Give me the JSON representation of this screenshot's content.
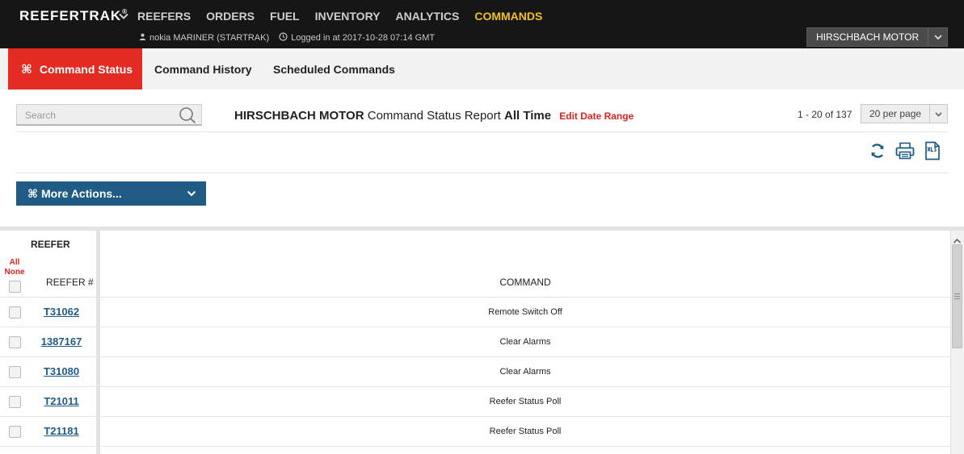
{
  "app": {
    "brand": "REEFERTRAK",
    "brand_mark": "®",
    "nav": [
      "REEFERS",
      "ORDERS",
      "FUEL",
      "INVENTORY",
      "ANALYTICS",
      "COMMANDS"
    ],
    "active_nav": "COMMANDS",
    "user": "nokia MARINER (STARTRAK)",
    "login": "Logged in at 2017-10-28 07:14 GMT",
    "company": "HIRSCHBACH MOTOR"
  },
  "tabs": {
    "command_status": "Command Status",
    "command_history": "Command History",
    "scheduled_commands": "Scheduled Commands"
  },
  "toolbar": {
    "search_placeholder": "Search",
    "report_company": "HIRSCHBACH MOTOR",
    "report_name": "Command Status Report",
    "report_range": "All Time",
    "edit_range": "Edit Date Range",
    "paging": "1 - 20 of 137",
    "per_page": "20 per page",
    "more_actions": "More Actions..."
  },
  "table": {
    "group_header": "REEFER",
    "all": "All",
    "none": "None",
    "col_reefer": "REEFER #",
    "col_command": "COMMAND",
    "rows": [
      {
        "reefer": "T31062",
        "command": "Remote Switch Off"
      },
      {
        "reefer": "1387167",
        "command": "Clear Alarms"
      },
      {
        "reefer": "T31080",
        "command": "Clear Alarms"
      },
      {
        "reefer": "T21011",
        "command": "Reefer Status Poll"
      },
      {
        "reefer": "T21181",
        "command": "Reefer Status Poll"
      }
    ]
  },
  "colors": {
    "topbar": "#161616",
    "active_nav": "#f2c21b",
    "active_tab": "#e32b24",
    "primary_button": "#1f5b85",
    "link": "#1f5b85",
    "alert_text": "#d7261f"
  },
  "icons": [
    "chevron-down-icon",
    "user-icon",
    "clock-icon",
    "command-icon",
    "search-icon",
    "refresh-icon",
    "print-icon",
    "xls-export-icon"
  ]
}
